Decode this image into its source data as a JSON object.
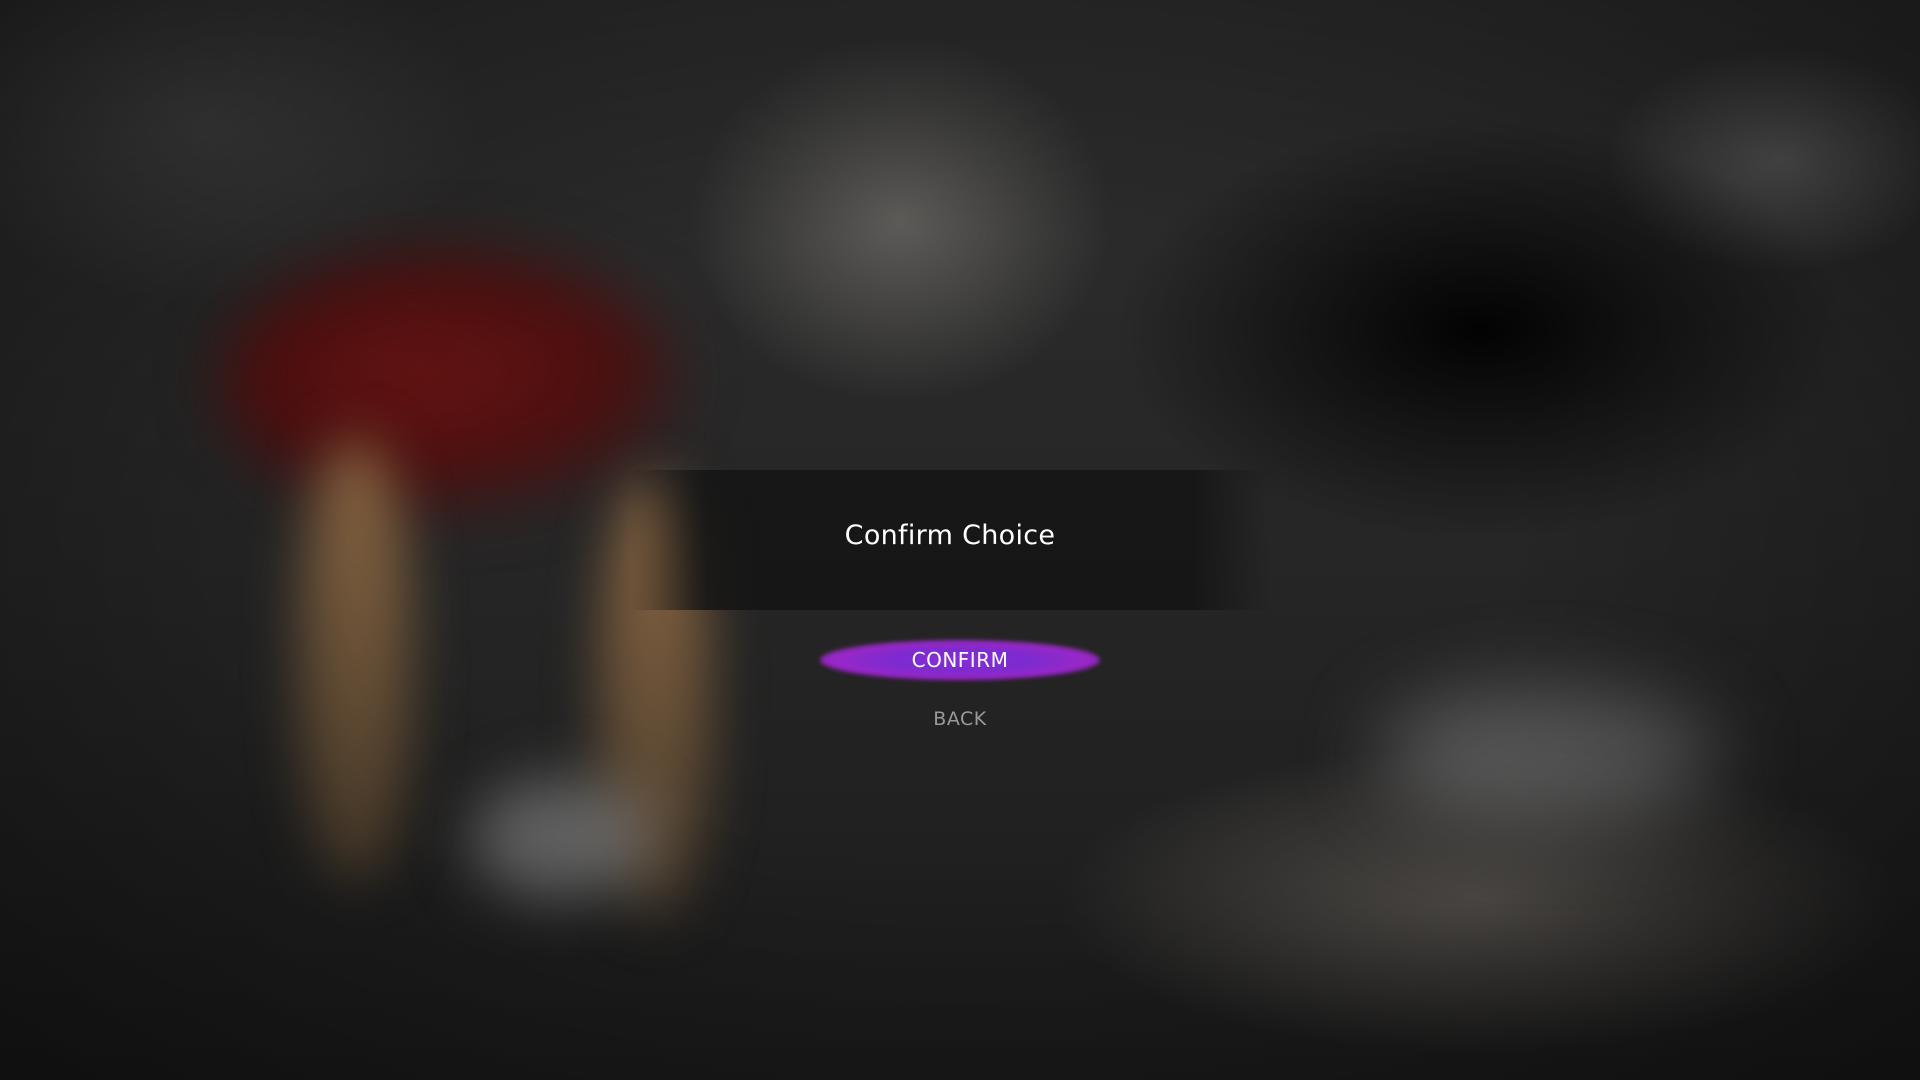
{
  "dialog": {
    "title": "Confirm Choice",
    "confirm_label": "CONFIRM",
    "back_label": "BACK"
  },
  "colors": {
    "confirm_highlight": "#8a2fd8",
    "confirm_highlight_edge": "#a827c8",
    "title_text": "#ffffff",
    "back_text": "#9a9a9a"
  }
}
